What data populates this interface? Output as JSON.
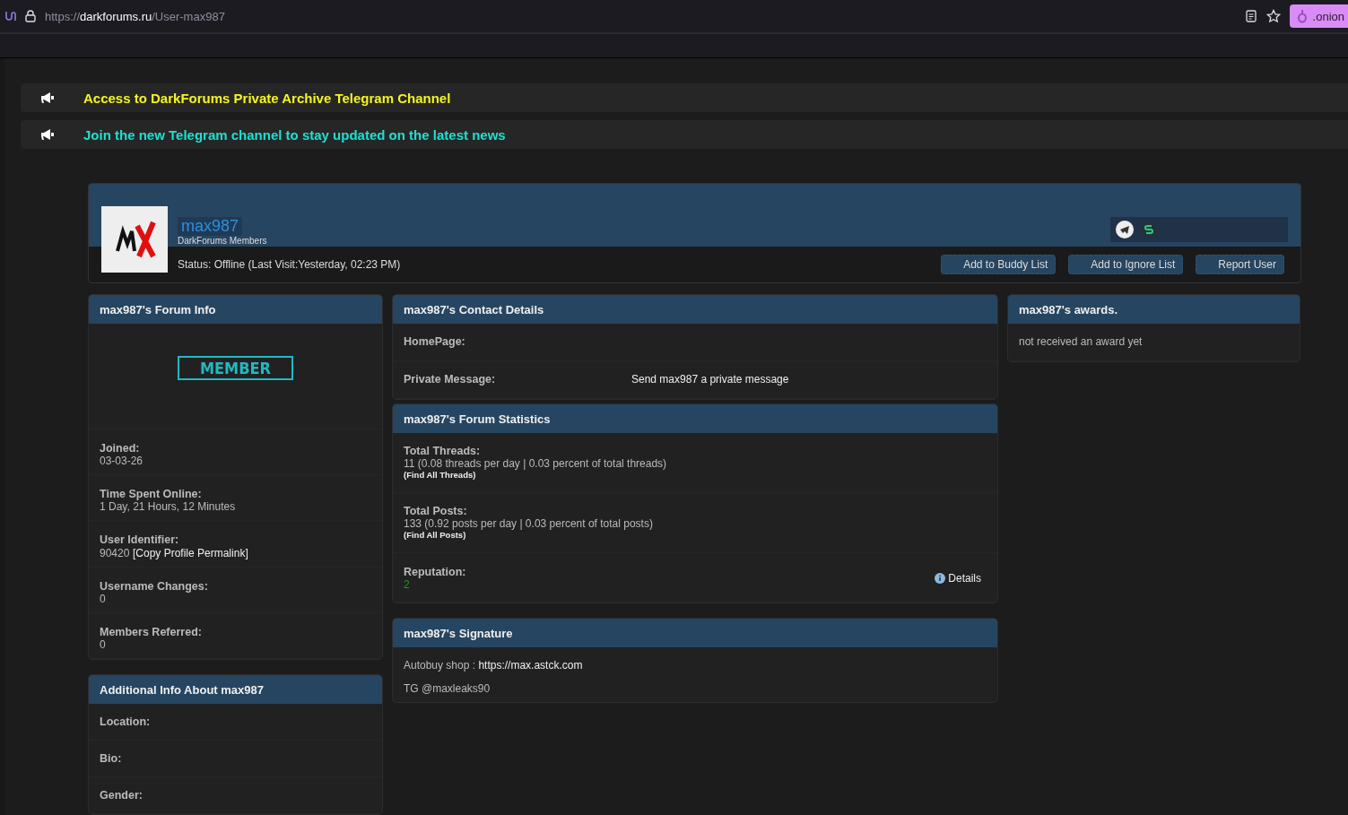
{
  "browser": {
    "url_scheme": "https://",
    "url_host": "darkforums.ru",
    "url_path": "/User-max987",
    "onion_badge": ".onion"
  },
  "announcements": [
    {
      "text": "Access to DarkForums Private Archive Telegram Channel",
      "color": "#f5f51e"
    },
    {
      "text": "Join the new Telegram channel to stay updated on the latest news",
      "color": "#1fe0d0"
    }
  ],
  "profile": {
    "username": "max987",
    "group": "DarkForums Members",
    "status": "Status: Offline (Last Visit:Yesterday, 02:23 PM)",
    "buttons": [
      "Add to Buddy List",
      "Add to Ignore List",
      "Report User"
    ]
  },
  "forum_info": {
    "title": "max987's Forum Info",
    "rank": "MEMBER",
    "fields": [
      {
        "label": "Joined:",
        "value": "03-03-26"
      },
      {
        "label": "Time Spent Online:",
        "value": "1 Day, 21 Hours, 12 Minutes"
      },
      {
        "label": "User Identifier:",
        "value": "90420",
        "link": "[Copy Profile Permalink]"
      },
      {
        "label": "Username Changes:",
        "value": "0"
      },
      {
        "label": "Members Referred:",
        "value": "0"
      }
    ]
  },
  "additional_info": {
    "title": "Additional Info About max987",
    "fields": [
      {
        "label": "Location:"
      },
      {
        "label": "Bio:"
      },
      {
        "label": "Gender:"
      }
    ]
  },
  "contact_details": {
    "title": "max987's Contact Details",
    "fields": [
      {
        "label": "HomePage:"
      },
      {
        "label": "Private Message:",
        "link": "Send max987 a private message"
      }
    ]
  },
  "forum_statistics": {
    "title": "max987's Forum Statistics",
    "fields": [
      {
        "label": "Total Threads:",
        "value": "11 (0.08 threads per day | 0.03 percent of total threads)",
        "link": "(Find All Threads)"
      },
      {
        "label": "Total Posts:",
        "value": "133 (0.92 posts per day | 0.03 percent of total posts)",
        "link": "(Find All Posts)"
      }
    ],
    "reputation": {
      "label": "Reputation:",
      "value": "2",
      "details": "Details"
    }
  },
  "signature": {
    "title": "max987's Signature",
    "lines": [
      {
        "text": "Autobuy shop : ",
        "link": "https://max.astck.com"
      },
      {
        "text": "TG @maxleaks90"
      }
    ]
  },
  "awards": {
    "title": "max987's awards.",
    "text": "not received an award yet"
  }
}
